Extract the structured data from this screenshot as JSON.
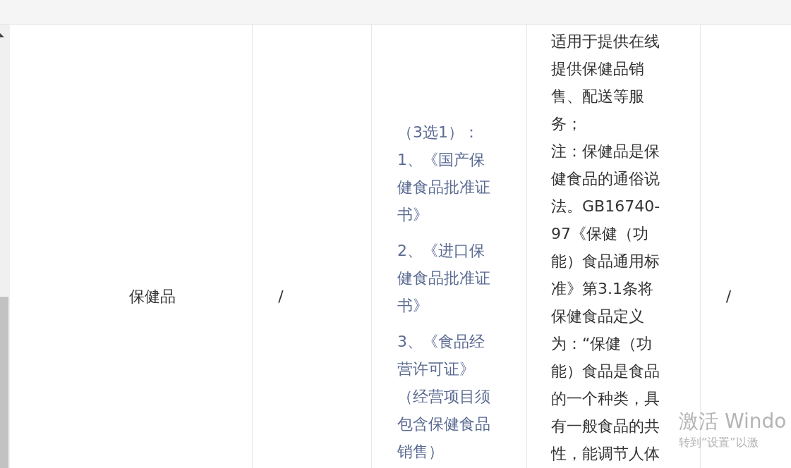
{
  "table": {
    "rows": [
      {
        "cells": [
          {
            "kind": "center",
            "text": "保健品"
          },
          {
            "kind": "center",
            "text": "/"
          },
          {
            "kind": "paragraphs",
            "paragraphs": [
              "（3选1）：\n1、《国产保健食品批准证书》",
              "2、《进口保健食品批准证书》",
              "3、《食品经营许可证》（经营项目须包含保健食品销售）"
            ]
          },
          {
            "kind": "top",
            "lines": [
              "适用于提供在线提供保健品销售、配送等服务；",
              "注：保健品是保健食品的通俗说法。GB16740-97《保健（功能）食品通用标准》第3.1条将保健食品定义为：“保健（功能）食品是食品的一个种类，具有一般食品的共性，能调节人体"
            ]
          },
          {
            "kind": "center",
            "text": "/"
          }
        ]
      }
    ]
  },
  "activation_notice": {
    "title": "激活 Windo",
    "subtitle": "转到“设置”以激"
  }
}
